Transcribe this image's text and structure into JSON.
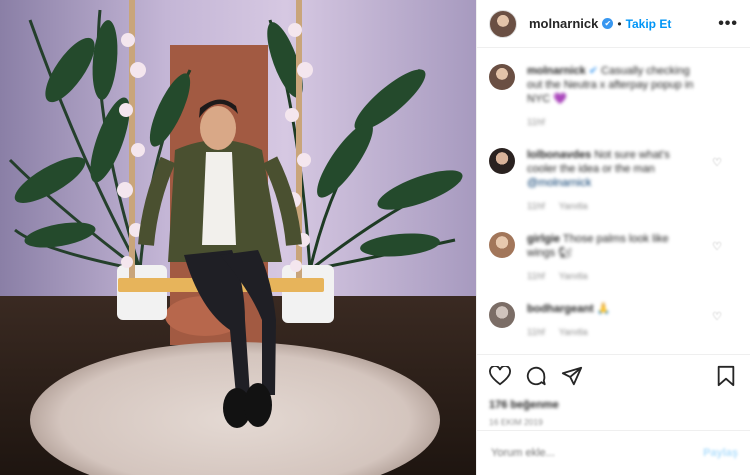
{
  "header": {
    "username": "molnarnick",
    "verified_mark": "✔",
    "separator": "•",
    "follow_label": "Takip Et",
    "more_label": "•••"
  },
  "comments": [
    {
      "username": "molnarnick",
      "badge": "✔",
      "text": "Casually checking out the Neutra x afterpay popup in NYC 💜",
      "time": "11hf"
    },
    {
      "username": "lolbonavdes",
      "text": "Not sure what's cooler the idea or the man",
      "mention": "@molnarnick",
      "time": "11hf",
      "reply": "Yanıtla",
      "heart": "♡"
    },
    {
      "username": "girlgie",
      "text": "Those palms look like wings 🐿",
      "time": "11hf",
      "reply": "Yanıtla",
      "heart": "♡"
    },
    {
      "username": "bodhargeant",
      "text": "🙏",
      "time": "11hf",
      "reply": "Yanıtla",
      "heart": "♡"
    }
  ],
  "actions": {
    "likes": "176 beğenme",
    "date": "16 Ekim 2019"
  },
  "add_comment": {
    "placeholder": "Yorum ekle...",
    "post_label": "Paylaş"
  },
  "icons": [
    "heart-icon",
    "comment-icon",
    "share-icon",
    "bookmark-icon",
    "verified-icon",
    "more-icon"
  ],
  "colors": {
    "accent": "#0095f6",
    "verified": "#3897f0",
    "muted": "#8e8e8e",
    "border": "#efefef"
  }
}
